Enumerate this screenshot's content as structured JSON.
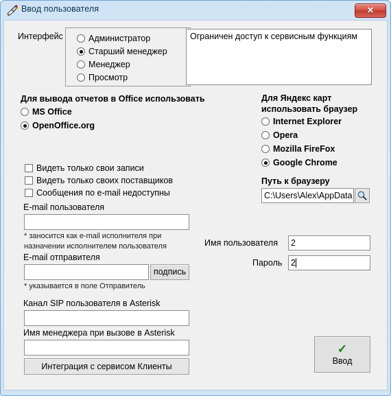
{
  "window": {
    "title": "Ввод пользователя",
    "icon": "pen-write-icon",
    "close_label": "✕",
    "frame_color": "#6ea6d9",
    "client_bg": "#f0f0f0",
    "close_color": "#c03a2e"
  },
  "interface": {
    "label": "Интерфейс",
    "options": [
      {
        "label": "Администратор",
        "selected": false
      },
      {
        "label": "Старший менеджер",
        "selected": true
      },
      {
        "label": "Менеджер",
        "selected": false
      },
      {
        "label": "Просмотр",
        "selected": false
      }
    ],
    "description": "Ограничен доступ к сервисным функциям"
  },
  "office": {
    "label": "Для вывода отчетов в Office использовать",
    "options": [
      {
        "label": "MS Office",
        "selected": false
      },
      {
        "label": "OpenOffice.org",
        "selected": true
      }
    ]
  },
  "browser": {
    "label_line1": "Для Яндекс карт",
    "label_line2": "использовать браузер",
    "options": [
      {
        "label": "Internet Explorer",
        "selected": false
      },
      {
        "label": "Opera",
        "selected": false
      },
      {
        "label": "Mozilla FireFox",
        "selected": false
      },
      {
        "label": "Google Chrome",
        "selected": true
      }
    ],
    "path_label": "Путь к браузеру",
    "path_value": "C:\\Users\\Alex\\AppData",
    "browse_icon": "magnifier-icon"
  },
  "permissions": [
    {
      "label": "Видеть только свои записи",
      "checked": false
    },
    {
      "label": "Видеть только своих поставщиков",
      "checked": false
    },
    {
      "label": "Сообщения по e-mail недоступны",
      "checked": false
    }
  ],
  "email_user": {
    "label": "E-mail пользователя",
    "value": "",
    "hint_line1": "* заносится как e-mail исполнителя при",
    "hint_line2": "назначении исполнителем пользователя"
  },
  "email_sender": {
    "label": "E-mail отправителя",
    "value": "",
    "button": "подпись",
    "hint": "* указывается в поле Отправитель"
  },
  "asterisk": {
    "sip_label": "Канал SIP пользователя в Asterisk",
    "sip_value": "",
    "manager_label": "Имя менеджера при вызове в Asterisk",
    "manager_value": ""
  },
  "credentials": {
    "user_label": "Имя пользователя",
    "user_value": "2",
    "password_label": "Пароль",
    "password_value": "2"
  },
  "actions": {
    "integration": "Интеграция с сервисом Клиенты",
    "submit_label": "Ввод",
    "submit_icon": "check-mark-icon"
  }
}
